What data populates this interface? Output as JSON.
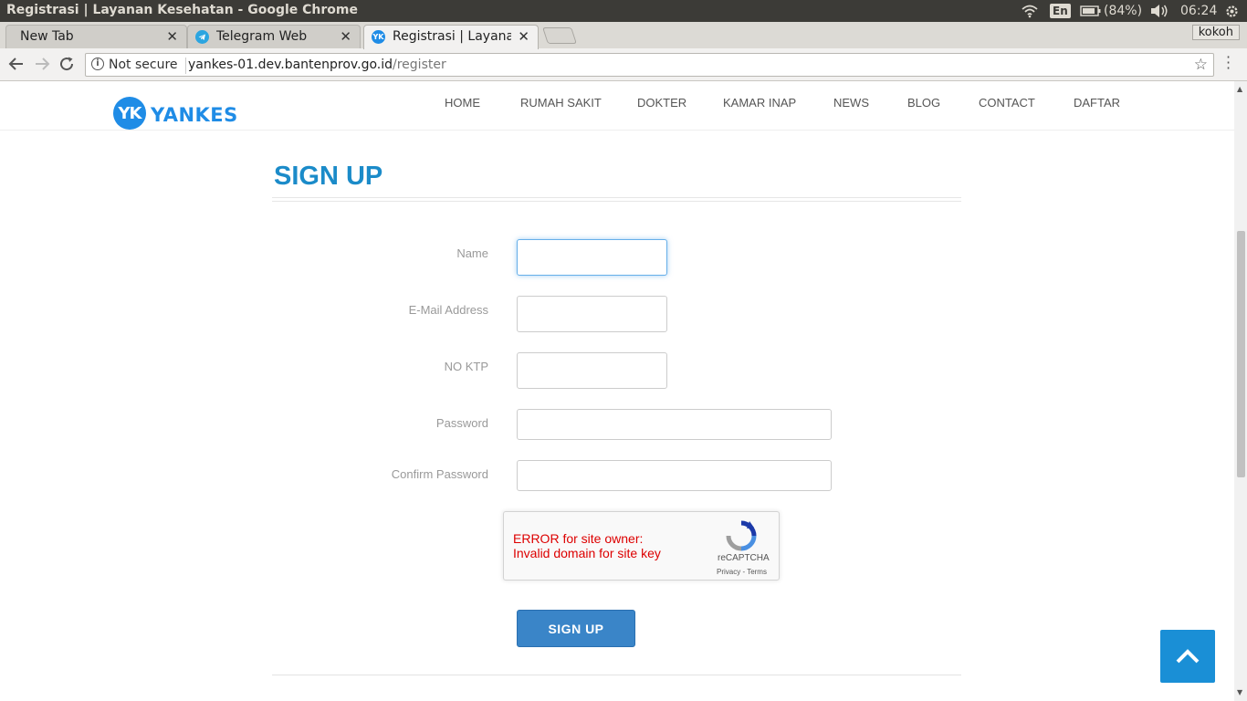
{
  "window": {
    "title": "Registrasi | Layanan Kesehatan - Google Chrome",
    "lang_indicator": "En",
    "battery": "(84%)",
    "clock": "06:24"
  },
  "tabs": [
    {
      "label": "New Tab"
    },
    {
      "label": "Telegram Web"
    },
    {
      "label": "Registrasi | Layanan Kesehatan"
    }
  ],
  "profile_name": "kokoh",
  "omnibox": {
    "security": "Not secure",
    "host": "yankes-01.dev.bantenprov.go.id",
    "path": "/register"
  },
  "site": {
    "logo_mark": "YK",
    "logo_text": "YANKES",
    "nav": [
      "HOME",
      "RUMAH SAKIT",
      "DOKTER",
      "KAMAR INAP",
      "NEWS",
      "BLOG",
      "CONTACT",
      "DAFTAR"
    ]
  },
  "form": {
    "title": "SIGN UP",
    "fields": [
      {
        "label": "Name",
        "value": ""
      },
      {
        "label": "E-Mail Address",
        "value": ""
      },
      {
        "label": "NO KTP",
        "value": ""
      },
      {
        "label": "Password",
        "value": ""
      },
      {
        "label": "Confirm Password",
        "value": ""
      }
    ],
    "recaptcha": {
      "error_line1": "ERROR for site owner:",
      "error_line2": "Invalid domain for site key",
      "brand": "reCAPTCHA",
      "links": "Privacy - Terms"
    },
    "submit_label": "SIGN UP"
  },
  "colors": {
    "accent": "#1b8bc9",
    "button": "#3a85c8",
    "error": "#dd0000",
    "back_to_top": "#1a8fd6"
  }
}
